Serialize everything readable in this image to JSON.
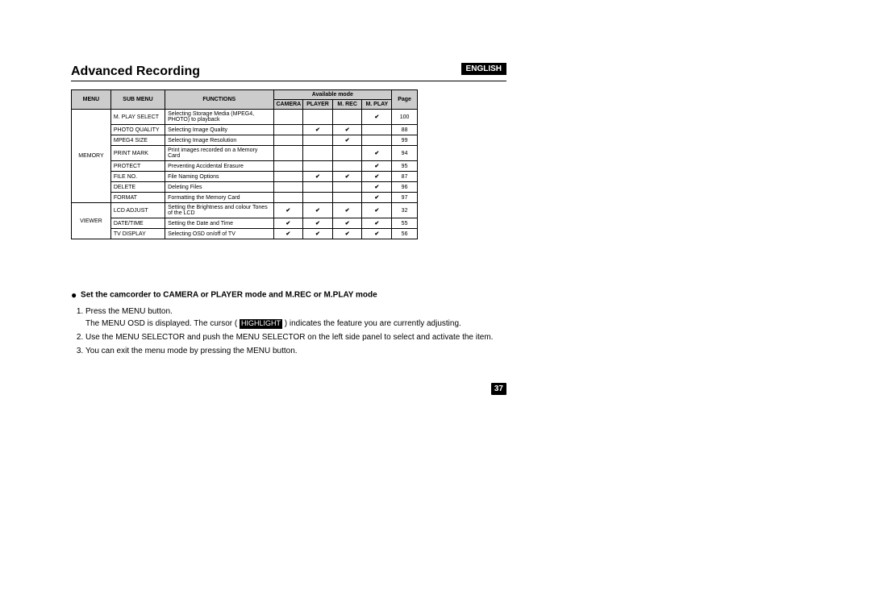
{
  "language_label": "ENGLISH",
  "section_title": "Advanced Recording",
  "table_headers": {
    "menu": "MENU",
    "sub_menu": "SUB MENU",
    "functions": "FUNCTIONS",
    "available_mode": "Available mode",
    "camera": "CAMERA",
    "player": "PLAYER",
    "mrec": "M. REC",
    "mplay": "M. PLAY",
    "page": "Page"
  },
  "groups": [
    {
      "menu": "MEMORY",
      "rows": [
        {
          "sub": "M. PLAY SELECT",
          "func": "Selecting Storage Media (MPEG4, PHOTO) to playback",
          "camera": "",
          "player": "",
          "mrec": "",
          "mplay": "✔",
          "page": "100"
        },
        {
          "sub": "PHOTO QUALITY",
          "func": "Selecting Image Quality",
          "camera": "",
          "player": "✔",
          "mrec": "✔",
          "mplay": "",
          "page": "88"
        },
        {
          "sub": "MPEG4 SIZE",
          "func": "Selecting Image Resolution",
          "camera": "",
          "player": "",
          "mrec": "✔",
          "mplay": "",
          "page": "99"
        },
        {
          "sub": "PRINT MARK",
          "func": "Print images recorded on a Memory Card",
          "camera": "",
          "player": "",
          "mrec": "",
          "mplay": "✔",
          "page": "94"
        },
        {
          "sub": "PROTECT",
          "func": "Preventing Accidental Erasure",
          "camera": "",
          "player": "",
          "mrec": "",
          "mplay": "✔",
          "page": "95"
        },
        {
          "sub": "FILE NO.",
          "func": "File Naming Options",
          "camera": "",
          "player": "✔",
          "mrec": "✔",
          "mplay": "✔",
          "page": "87"
        },
        {
          "sub": "DELETE",
          "func": "Deleting Files",
          "camera": "",
          "player": "",
          "mrec": "",
          "mplay": "✔",
          "page": "96"
        },
        {
          "sub": "FORMAT",
          "func": "Formatting the Memory Card",
          "camera": "",
          "player": "",
          "mrec": "",
          "mplay": "✔",
          "page": "97"
        }
      ]
    },
    {
      "menu": "VIEWER",
      "rows": [
        {
          "sub": "LCD ADJUST",
          "func": "Setting the Brightness and colour Tones of the LCD",
          "camera": "✔",
          "player": "✔",
          "mrec": "✔",
          "mplay": "✔",
          "page": "32"
        },
        {
          "sub": "DATE/TIME",
          "func": "Setting the Date and Time",
          "camera": "✔",
          "player": "✔",
          "mrec": "✔",
          "mplay": "✔",
          "page": "55"
        },
        {
          "sub": "TV DISPLAY",
          "func": "Selecting OSD on/off of TV",
          "camera": "✔",
          "player": "✔",
          "mrec": "✔",
          "mplay": "✔",
          "page": "56"
        }
      ]
    }
  ],
  "instruction": {
    "bullet_title": "Set the camcorder to CAMERA or PLAYER mode and M.REC or M.PLAY mode",
    "steps": {
      "s1": "Press the MENU button.",
      "s1b_pre": "The MENU OSD is displayed. The cursor ( ",
      "s1b_highlight": "HIGHLIGHT",
      "s1b_post": " ) indicates the feature you are currently adjusting.",
      "s2": "Use the MENU SELECTOR and push the MENU SELECTOR on the left side panel to select and activate the item.",
      "s3": "You can exit the menu mode by pressing the MENU button."
    }
  },
  "page_number": "37"
}
